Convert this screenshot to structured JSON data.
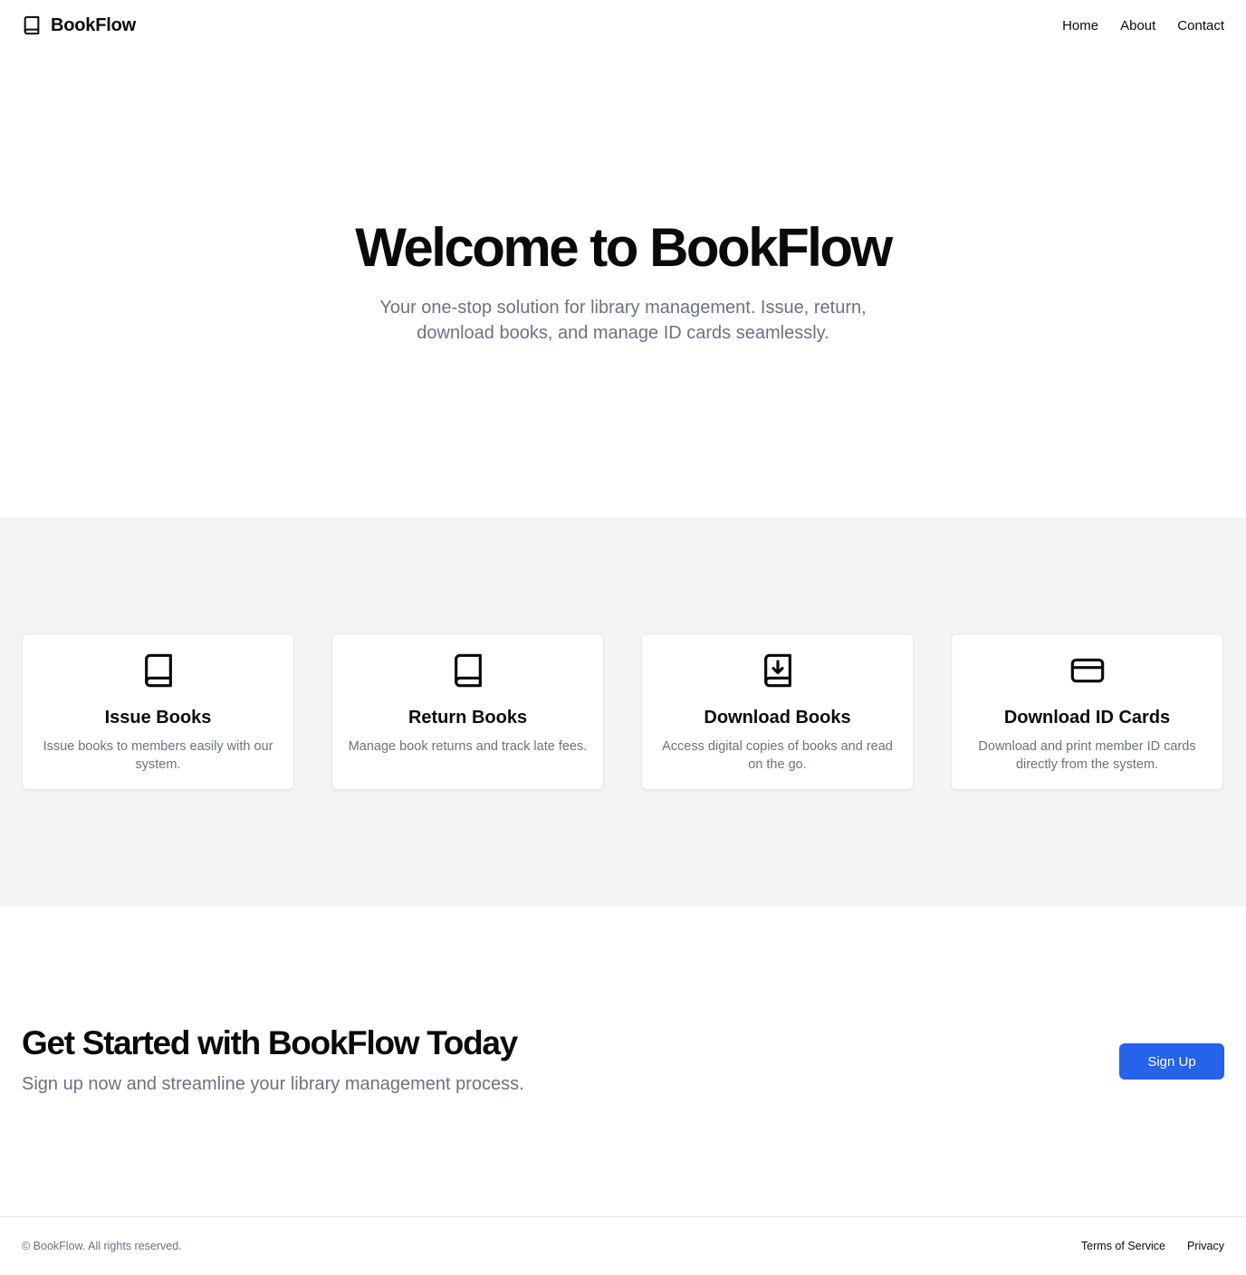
{
  "header": {
    "brand_icon": "book-icon",
    "brand_name": "BookFlow",
    "nav": [
      {
        "label": "Home"
      },
      {
        "label": "About"
      },
      {
        "label": "Contact"
      }
    ]
  },
  "hero": {
    "title": "Welcome to BookFlow",
    "subtitle": "Your one-stop solution for library management. Issue, return, download books, and manage ID cards seamlessly."
  },
  "features": [
    {
      "icon": "book-icon",
      "title": "Issue Books",
      "description": "Issue books to members easily with our system."
    },
    {
      "icon": "book-icon",
      "title": "Return Books",
      "description": "Manage book returns and track late fees."
    },
    {
      "icon": "book-download-icon",
      "title": "Download Books",
      "description": "Access digital copies of books and read on the go."
    },
    {
      "icon": "id-card-icon",
      "title": "Download ID Cards",
      "description": "Download and print member ID cards directly from the system."
    }
  ],
  "cta": {
    "title": "Get Started with BookFlow Today",
    "subtitle": "Sign up now and streamline your library management process.",
    "button_label": "Sign Up"
  },
  "footer": {
    "copyright": "© BookFlow. All rights reserved.",
    "links": [
      {
        "label": "Terms of Service"
      },
      {
        "label": "Privacy"
      }
    ]
  },
  "colors": {
    "accent": "#2563eb",
    "muted_text": "#6b7280",
    "section_bg": "#f3f4f6"
  }
}
